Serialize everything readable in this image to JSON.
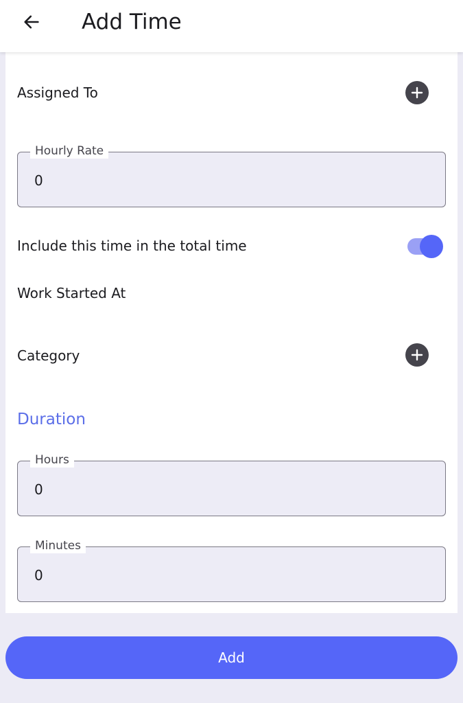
{
  "appbar": {
    "title": "Add Time",
    "back_icon": "arrow-left-icon"
  },
  "form": {
    "assigned_to": {
      "label": "Assigned To",
      "icon": "plus-circle-icon"
    },
    "hourly_rate": {
      "label": "Hourly Rate",
      "value": "0"
    },
    "include_total": {
      "label": "Include this time in the total time",
      "checked": true
    },
    "work_started": {
      "label": "Work Started At"
    },
    "category": {
      "label": "Category",
      "icon": "plus-circle-icon"
    },
    "duration": {
      "title": "Duration",
      "hours": {
        "label": "Hours",
        "value": "0"
      },
      "minutes": {
        "label": "Minutes",
        "value": "0"
      }
    }
  },
  "footer": {
    "add_label": "Add"
  },
  "colors": {
    "accent": "#5566f8",
    "accent_light": "#9aa0f5",
    "section_title": "#5b6ee8",
    "field_bg": "#edecf6",
    "page_bg": "#ecebf5",
    "plus_button": "#45444c"
  }
}
